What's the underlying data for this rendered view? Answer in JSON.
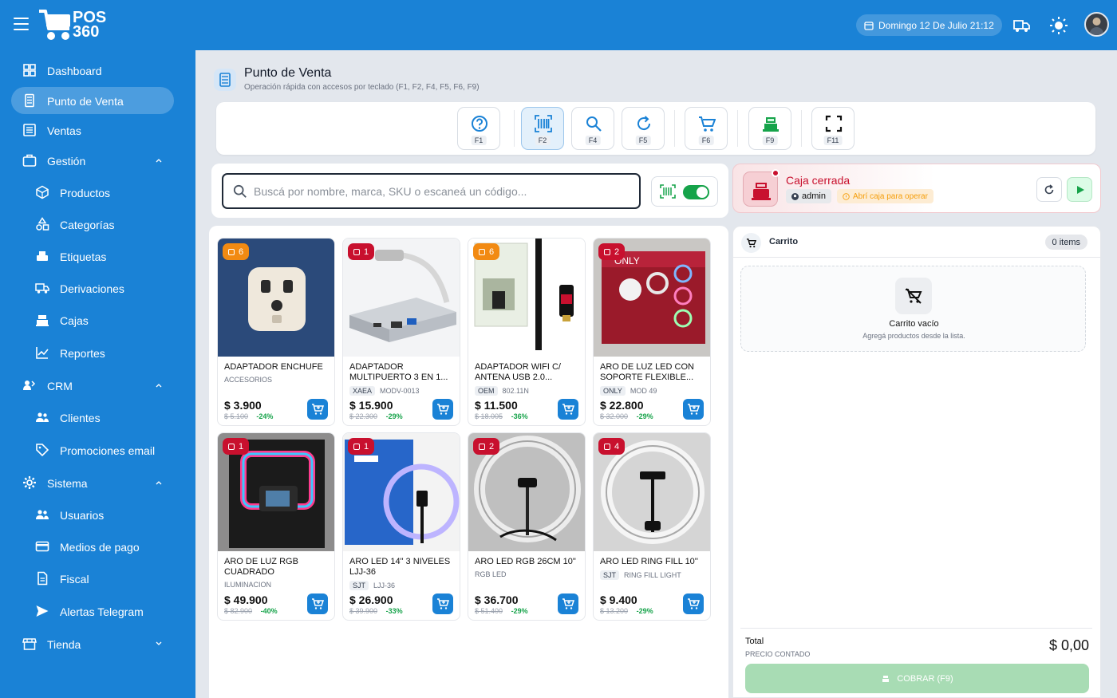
{
  "app": {
    "logo_text_top": "POS",
    "logo_text_bottom": "360"
  },
  "topbar": {
    "date_label": "Domingo 12 De Julio 21:12",
    "icons": [
      "menu-icon",
      "calendar-icon",
      "delivery-truck-icon",
      "sun-icon",
      "avatar"
    ]
  },
  "sidebar": {
    "items": [
      {
        "label": "Dashboard",
        "icon": "dashboard-icon"
      },
      {
        "label": "Punto de Venta",
        "icon": "pos-terminal-icon",
        "active": true
      },
      {
        "label": "Ventas",
        "icon": "list-icon"
      },
      {
        "label": "Gestión",
        "icon": "briefcase-icon",
        "expanded": true
      },
      {
        "label": "Productos",
        "icon": "cube-icon"
      },
      {
        "label": "Categorías",
        "icon": "shapes-icon"
      },
      {
        "label": "Etiquetas",
        "icon": "label-printer-icon"
      },
      {
        "label": "Derivaciones",
        "icon": "truck-icon"
      },
      {
        "label": "Cajas",
        "icon": "cash-register-icon"
      },
      {
        "label": "Reportes",
        "icon": "chart-line-icon"
      },
      {
        "label": "CRM",
        "icon": "crm-icon",
        "expanded": true
      },
      {
        "label": "Clientes",
        "icon": "people-icon"
      },
      {
        "label": "Promociones email",
        "icon": "tag-icon"
      },
      {
        "label": "Sistema",
        "icon": "gear-icon",
        "expanded": true
      },
      {
        "label": "Usuarios",
        "icon": "people-icon"
      },
      {
        "label": "Medios de pago",
        "icon": "credit-card-icon"
      },
      {
        "label": "Fiscal",
        "icon": "document-icon"
      },
      {
        "label": "Alertas Telegram",
        "icon": "send-icon"
      },
      {
        "label": "Tienda",
        "icon": "store-icon",
        "expanded": false
      }
    ]
  },
  "page": {
    "title": "Punto de Venta",
    "subtitle": "Operación rápida con accesos por teclado (F1, F2, F4, F5, F6, F9)"
  },
  "toolbar": {
    "buttons": [
      {
        "key": "F1",
        "icon": "help-icon"
      },
      {
        "key": "F2",
        "icon": "barcode-scan-icon",
        "selected": true
      },
      {
        "key": "F4",
        "icon": "search-icon"
      },
      {
        "key": "F5",
        "icon": "refresh-icon"
      },
      {
        "key": "F6",
        "icon": "cart-icon"
      },
      {
        "key": "F9",
        "icon": "cash-register-icon"
      },
      {
        "key": "F11",
        "icon": "fullscreen-icon"
      }
    ]
  },
  "search": {
    "placeholder": "Buscá por nombre, marca, SKU o escaneá un código...",
    "value": "",
    "scan_toggle_on": true
  },
  "products": [
    {
      "stock": "6",
      "badge_color": "#f28a12",
      "name": "ADAPTADOR ENCHUFE",
      "category": "ACCESORIOS",
      "brand": "",
      "model": "",
      "price": "$ 3.900",
      "old_price": "$ 5.100",
      "discount": "-24%"
    },
    {
      "stock": "1",
      "badge_color": "#c8102e",
      "name": "ADAPTADOR MULTIPUERTO 3 EN 1...",
      "category": "",
      "brand": "XAEA",
      "model": "MODV-0013",
      "price": "$ 15.900",
      "old_price": "$ 22.300",
      "discount": "-29%"
    },
    {
      "stock": "6",
      "badge_color": "#f28a12",
      "name": "ADAPTADOR WIFI C/ ANTENA USB 2.0...",
      "category": "",
      "brand": "OEM",
      "model": "802.11N",
      "price": "$ 11.500",
      "old_price": "$ 18.005",
      "discount": "-36%"
    },
    {
      "stock": "2",
      "badge_color": "#c8102e",
      "name": "ARO DE LUZ LED CON SOPORTE FLEXIBLE...",
      "category": "",
      "brand": "ONLY",
      "model": "MOD 49",
      "price": "$ 22.800",
      "old_price": "$ 32.000",
      "discount": "-29%"
    },
    {
      "stock": "1",
      "badge_color": "#c8102e",
      "name": "ARO DE LUZ RGB CUADRADO",
      "category": "ILUMINACION",
      "brand": "",
      "model": "",
      "price": "$ 49.900",
      "old_price": "$ 82.900",
      "discount": "-40%"
    },
    {
      "stock": "1",
      "badge_color": "#c8102e",
      "name": "ARO LED 14\" 3 NIVELES LJJ-36",
      "category": "",
      "brand": "SJT",
      "model": "LJJ-36",
      "price": "$ 26.900",
      "old_price": "$ 39.900",
      "discount": "-33%"
    },
    {
      "stock": "2",
      "badge_color": "#c8102e",
      "name": "ARO LED RGB 26CM 10\"",
      "category": "RGB LED",
      "brand": "",
      "model": "",
      "price": "$ 36.700",
      "old_price": "$ 51.400",
      "discount": "-29%"
    },
    {
      "stock": "4",
      "badge_color": "#c8102e",
      "name": "ARO LED RING FILL 10''",
      "category": "",
      "brand": "SJT",
      "model": "RING FILL LIGHT",
      "price": "$ 9.400",
      "old_price": "$ 13.200",
      "discount": "-29%"
    }
  ],
  "caja": {
    "title": "Caja cerrada",
    "user": "admin",
    "warning": "Abrí caja para operar"
  },
  "cart": {
    "title": "Carrito",
    "items_label": "0 items",
    "empty_title": "Carrito vacío",
    "empty_sub": "Agregá productos desde la lista.",
    "total_label": "Total",
    "price_type": "PRECIO CONTADO",
    "total_value": "$ 0,00",
    "pay_label": "COBRAR (F9)"
  },
  "colors": {
    "primary": "#1a82d6",
    "danger": "#c8102e",
    "warning": "#f28a12",
    "success": "#16a34a",
    "pay_disabled": "#a8dcb4"
  }
}
